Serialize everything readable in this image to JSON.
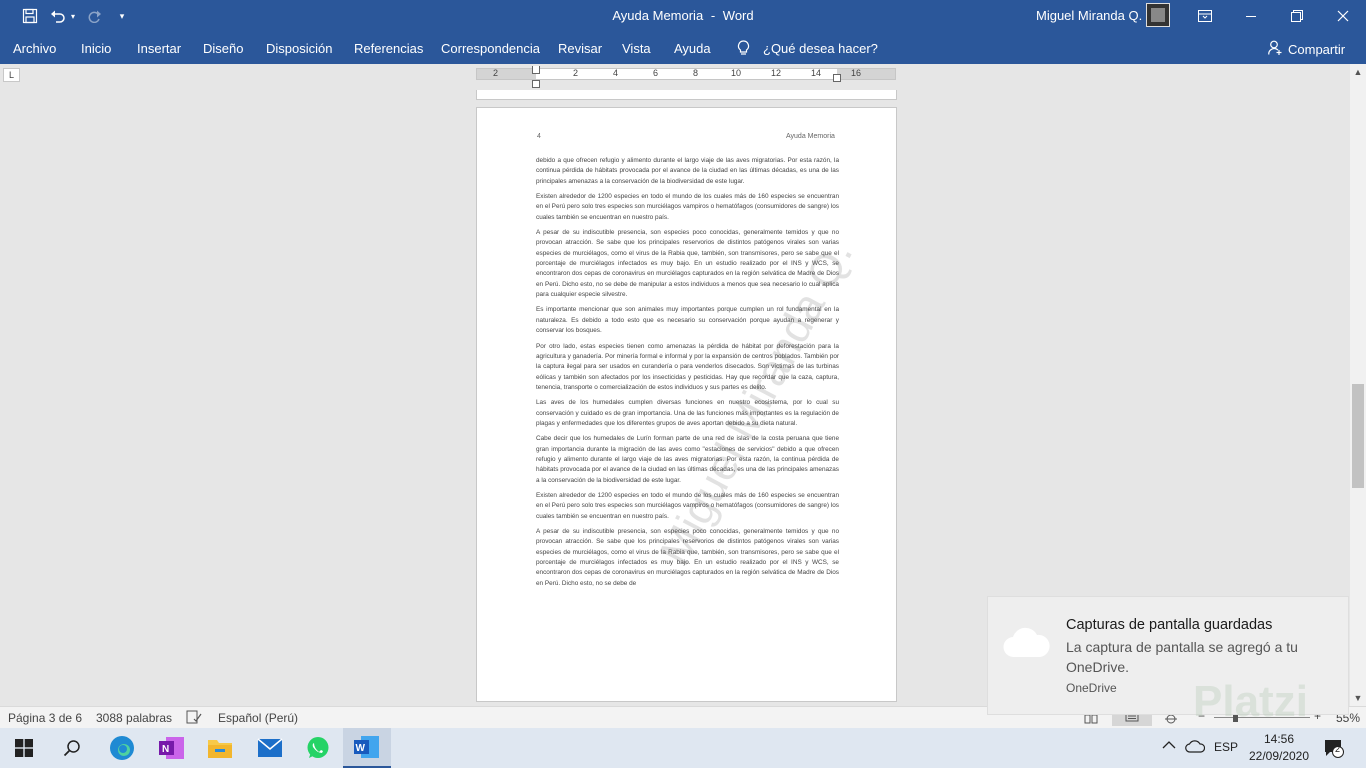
{
  "titlebar": {
    "document_title": "Ayuda Memoria",
    "separator": "-",
    "app_name": "Word",
    "user_name": "Miguel Miranda Q.",
    "save_icon": "save-icon",
    "undo_icon": "undo-icon",
    "redo_icon": "redo-icon",
    "customize_icon": "customize-quick-access-icon"
  },
  "ribbon": {
    "tabs": [
      "Archivo",
      "Inicio",
      "Insertar",
      "Diseño",
      "Disposición",
      "Referencias",
      "Correspondencia",
      "Revisar",
      "Vista",
      "Ayuda"
    ],
    "tell_me": "¿Qué desea hacer?",
    "share": "Compartir"
  },
  "ruler": {
    "numbers": [
      "2",
      "2",
      "4",
      "6",
      "8",
      "10",
      "12",
      "14",
      "16"
    ]
  },
  "page": {
    "number": "4",
    "header": "Ayuda Memoria",
    "watermark": "Miguel Miranda Q.",
    "paragraphs": [
      "debido a que ofrecen refugio y alimento durante el largo viaje de las aves migratorias. Por esta razón, la continua pérdida de hábitats provocada por el avance de la ciudad en las últimas décadas, es una de las principales amenazas a la conservación de la biodiversidad de este lugar.",
      "Existen alrededor de 1200 especies en todo el mundo de los cuales más de 160 especies se encuentran en el Perú pero solo tres especies son murciélagos vampiros o hematófagos (consumidores de sangre) los cuales también se encuentran en nuestro país.",
      "A pesar de su indiscutible presencia, son especies poco conocidas, generalmente temidos y que no provocan atracción. Se sabe que los principales reservorios de distintos patógenos virales son varias especies de murciélagos, como el virus de la Rabia que, también, son transmisores, pero se sabe que el porcentaje de murciélagos infectados es muy bajo. En un estudio realizado por el INS y WCS, se encontraron dos cepas de coronavirus en murciélagos capturados en la región selvática de Madre de Dios en Perú. Dicho esto, no se debe de manipular a estos individuos a menos que sea necesario lo cual aplica para cualquier especie silvestre.",
      "Es importante mencionar que son animales muy importantes porque cumplen un rol fundamental en la naturaleza. Es debido a todo esto que es necesario su conservación porque ayudan a regenerar y conservar los bosques.",
      "Por otro lado, estas especies tienen como amenazas la pérdida de hábitat por deforestación para la agricultura y ganadería. Por minería formal e informal y por la expansión de centros poblados. También por la captura ilegal para ser usados en curandería o para venderlos disecados. Son víctimas de las turbinas eólicas y también son afectados por los insecticidas y pesticidas. Hay que recordar que la caza, captura, tenencia, transporte o comercialización de estos individuos y sus partes es delito.",
      "Las aves de los humedales cumplen diversas funciones en nuestro ecosistema, por lo cual su conservación y cuidado es de gran importancia. Una de las funciones más importantes es la regulación de plagas y enfermedades que los diferentes grupos de aves aportan debido a su dieta natural.",
      "Cabe decir que los humedales de Lurín forman parte de una red de islas de la costa peruana que tiene gran importancia durante la migración de las aves como \"estaciones de servicios\" debido a que ofrecen refugio y alimento durante el largo viaje de las aves migratorias. Por esta razón, la continua pérdida de hábitats provocada por el avance de la ciudad en las últimas décadas, es una de las principales amenazas a la conservación de la biodiversidad de este lugar.",
      "Existen alrededor de 1200 especies en todo el mundo de los cuales más de 160 especies se encuentran en el Perú pero solo tres especies son murciélagos vampiros o hematófagos (consumidores de sangre) los cuales también se encuentran en nuestro país.",
      "A pesar de su indiscutible presencia, son especies poco conocidas, generalmente temidos y que no provocan atracción. Se sabe que los principales reservorios de distintos patógenos virales son varias especies de murciélagos, como el virus de la Rabia que, también, son transmisores, pero se sabe que el porcentaje de murciélagos infectados es muy bajo. En un estudio realizado por el INS y WCS, se encontraron dos cepas de coronavirus en murciélagos capturados en la región selvática de Madre de Dios en Perú. Dicho esto, no se debe de"
    ]
  },
  "statusbar": {
    "page_info": "Página 3 de 6",
    "word_count": "3088 palabras",
    "language": "Español (Perú)",
    "zoom": "55%"
  },
  "toast": {
    "title": "Capturas de pantalla guardadas",
    "message": "La captura de pantalla se agregó a tu OneDrive.",
    "app": "OneDrive",
    "logo_text": "Platzi"
  },
  "taskbar": {
    "language": "ESP",
    "time": "14:56",
    "date": "22/09/2020",
    "notifications": "2"
  }
}
